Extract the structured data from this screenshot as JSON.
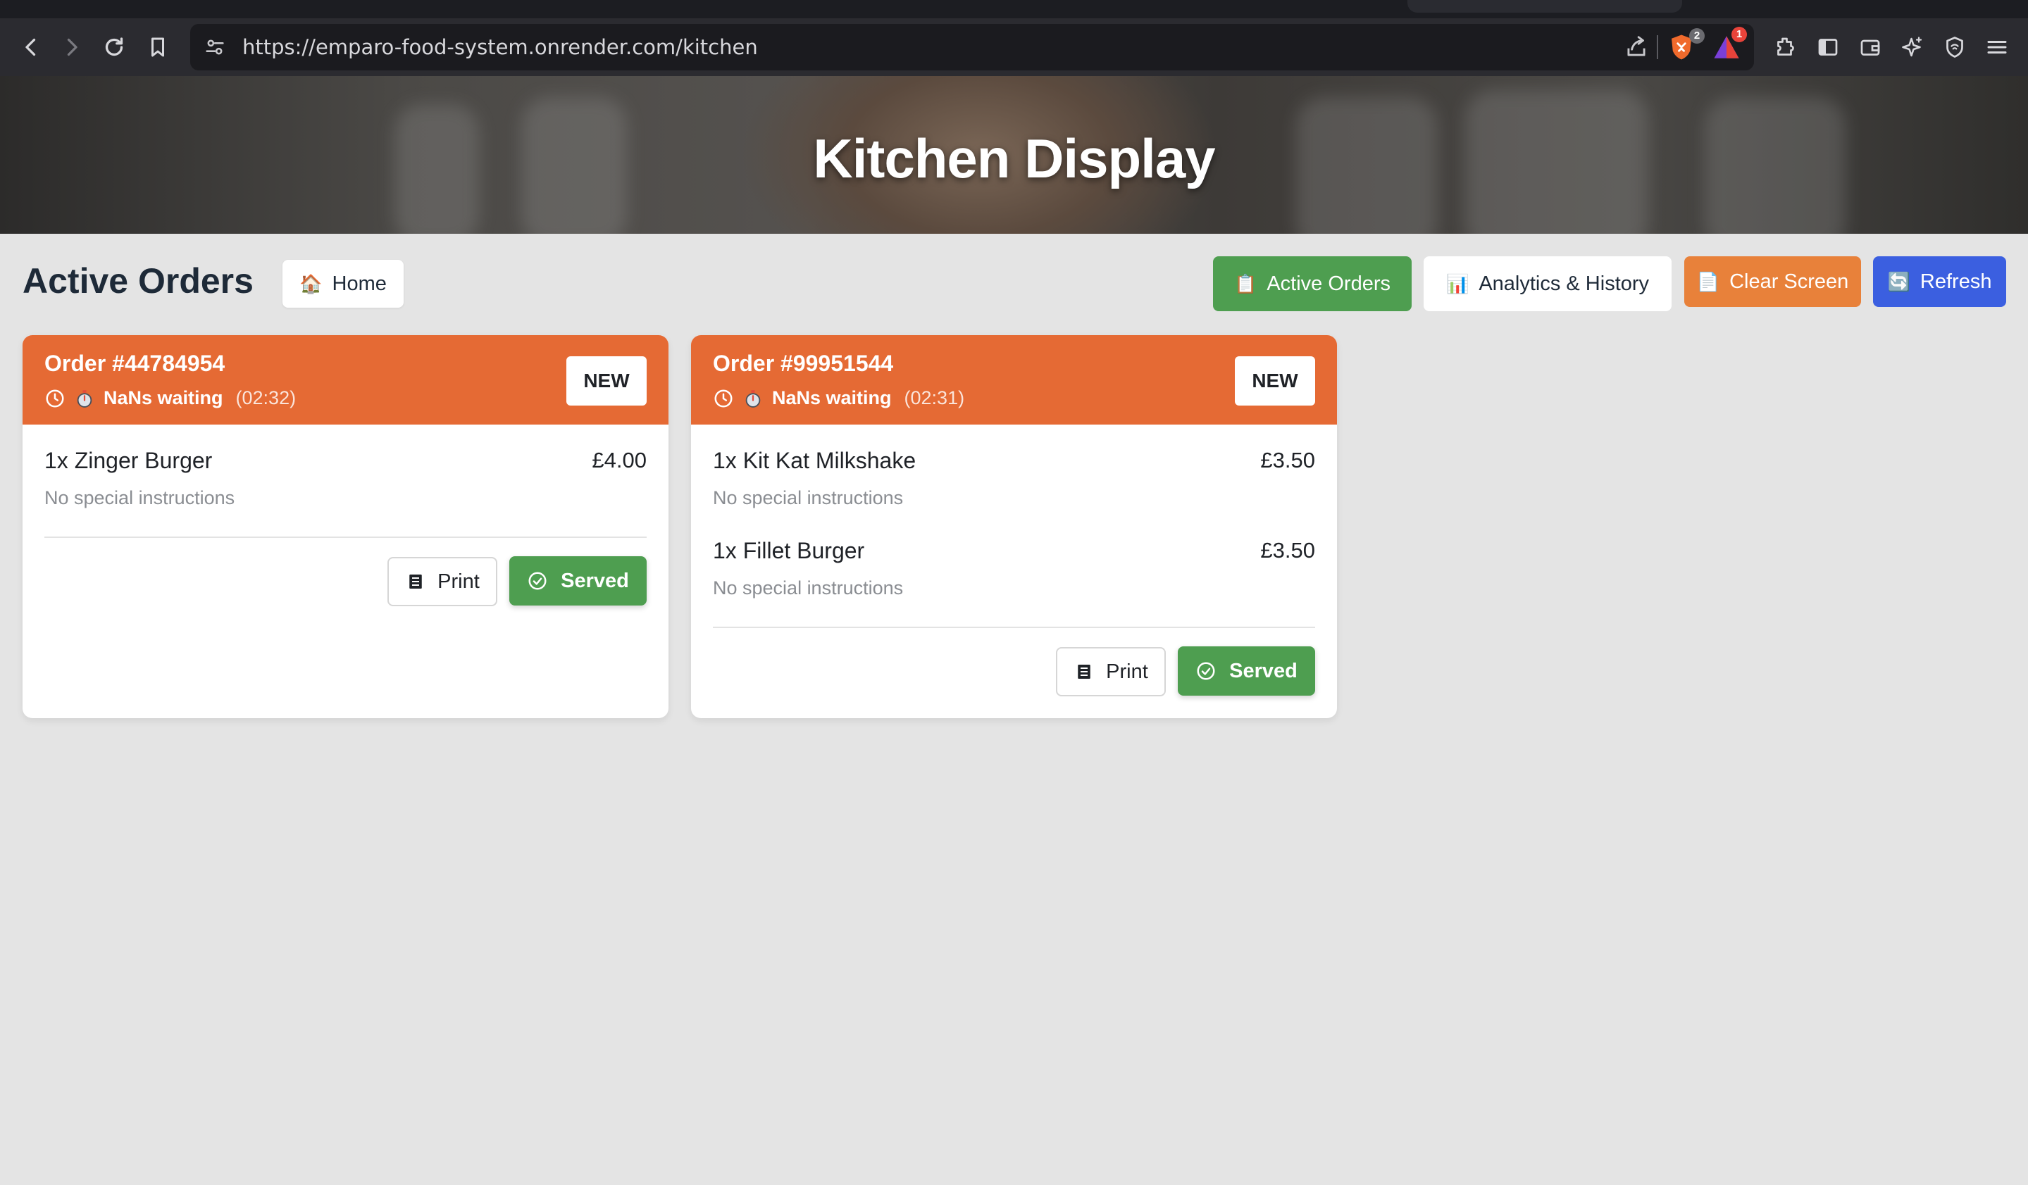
{
  "browser": {
    "url": "https://emparo-food-system.onrender.com/kitchen",
    "brave_shields_count": "2",
    "rewards_count": "1"
  },
  "hero": {
    "title": "Kitchen Display"
  },
  "header": {
    "title": "Active Orders",
    "home_label": "Home",
    "home_icon": "🏠",
    "nav": {
      "active_orders": {
        "label": "Active Orders",
        "icon": "📋"
      },
      "analytics": {
        "label": "Analytics & History",
        "icon": "📊"
      },
      "clear_screen": {
        "label": "Clear Screen",
        "icon": "📄"
      },
      "refresh": {
        "label": "Refresh",
        "icon": "🔄"
      }
    }
  },
  "colors": {
    "card_header": "#e56a34",
    "served": "#4e9e50",
    "clear": "#e8813a",
    "refresh": "#3b5fe0",
    "background": "#e4e4e4"
  },
  "orders": [
    {
      "number": "Order #44784954",
      "status": "NEW",
      "waiting": "NaNs waiting",
      "elapsed": "(02:32)",
      "items": [
        {
          "name": "1x Zinger Burger",
          "price": "£4.00",
          "note": "No special instructions"
        }
      ],
      "print_label": "Print",
      "served_label": "Served"
    },
    {
      "number": "Order #99951544",
      "status": "NEW",
      "waiting": "NaNs waiting",
      "elapsed": "(02:31)",
      "items": [
        {
          "name": "1x Kit Kat Milkshake",
          "price": "£3.50",
          "note": "No special instructions"
        },
        {
          "name": "1x Fillet Burger",
          "price": "£3.50",
          "note": "No special instructions"
        }
      ],
      "print_label": "Print",
      "served_label": "Served"
    }
  ]
}
